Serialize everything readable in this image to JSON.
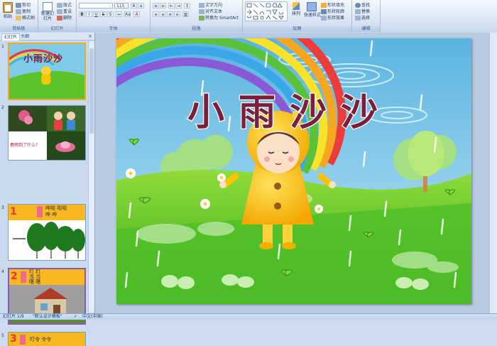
{
  "ribbon": {
    "groups": {
      "clipboard": "剪贴板",
      "slides": "幻灯片",
      "font": "字体",
      "paragraph": "段落",
      "drawing": "绘图",
      "editing": "编辑"
    },
    "paste": "粘贴",
    "cut": "剪切",
    "copy": "复制",
    "format_painter": "格式刷",
    "new_slide": "新建幻灯片",
    "layout": "版式",
    "reset": "重设",
    "delete": "删除",
    "font_size": "115",
    "text_direction": "文字方向",
    "align_text": "对齐文本",
    "convert_smartart": "转换为 SmartArt",
    "arrange": "排列",
    "quick_styles": "快速样式",
    "shape_fill": "形状填充",
    "shape_outline": "形状轮廓",
    "shape_effects": "形状效果",
    "find": "查找",
    "replace": "替换",
    "select": "选择"
  },
  "panel": {
    "tab_slides": "幻灯片",
    "tab_outline": "大纲",
    "close": "×"
  },
  "thumbnails": [
    {
      "num": "1",
      "title": "小雨沙沙"
    },
    {
      "num": "2",
      "caption": "春雨到了什么?"
    },
    {
      "num": "3",
      "lines": [
        "哗啦  啦啦",
        "哗    哗"
      ]
    },
    {
      "num": "4",
      "lines": [
        "叮  叮",
        "当  当",
        "嗒  嗒"
      ]
    },
    {
      "num": "5",
      "lines": [
        "叮令  令令"
      ]
    }
  ],
  "slide": {
    "title": "小雨沙沙"
  },
  "status": {
    "slide_info": "幻灯片 1/9",
    "theme": "\"默认设计模板\"",
    "language": "中文(中国)"
  },
  "colors": {
    "ribbon_bg": "#dbe6f5",
    "selection": "#f5a623",
    "title_fill": "#7a1f3d"
  }
}
